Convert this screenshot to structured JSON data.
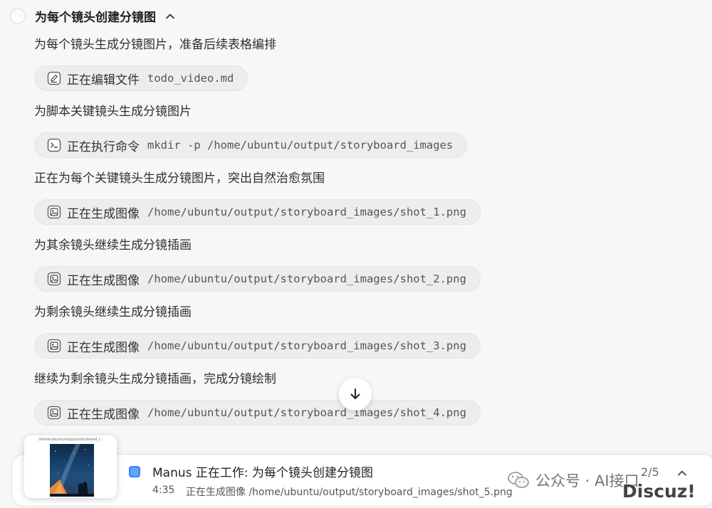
{
  "task": {
    "title": "为每个镜头创建分镜图"
  },
  "steps": [
    {
      "text": "为每个镜头生成分镜图片，准备后续表格编排",
      "tool": {
        "icon": "edit-icon",
        "label": "正在编辑文件",
        "arg": "todo_video.md"
      }
    },
    {
      "text": "为脚本关键镜头生成分镜图片",
      "tool": {
        "icon": "terminal-icon",
        "label": "正在执行命令",
        "arg": "mkdir -p /home/ubuntu/output/storyboard_images"
      }
    },
    {
      "text": "正在为每个关键镜头生成分镜图片，突出自然治愈氛围",
      "tool": {
        "icon": "image-icon",
        "label": "正在生成图像",
        "arg": "/home/ubuntu/output/storyboard_images/shot_1.png"
      }
    },
    {
      "text": "为其余镜头继续生成分镜插画",
      "tool": {
        "icon": "image-icon",
        "label": "正在生成图像",
        "arg": "/home/ubuntu/output/storyboard_images/shot_2.png"
      }
    },
    {
      "text": "为剩余镜头继续生成分镜插画",
      "tool": {
        "icon": "image-icon",
        "label": "正在生成图像",
        "arg": "/home/ubuntu/output/storyboard_images/shot_3.png"
      }
    },
    {
      "text": "继续为剩余镜头生成分镜插画，完成分镜绘制",
      "tool": {
        "icon": "image-icon",
        "label": "正在生成图像",
        "arg": "/home/ubuntu/output/storyboard_images/shot_4.png"
      }
    }
  ],
  "status": {
    "thumbnail_caption": "/home/ubuntu/output/storyboard_i...",
    "title": "Manus 正在工作: 为每个镜头创建分镜图",
    "time": "4:35",
    "description": "正在生成图像 /home/ubuntu/output/storyboard_images/shot_5.png",
    "progress": "2/5"
  },
  "watermark": {
    "text": "公众号 · AI接口",
    "site": "Discuz!"
  },
  "colors": {
    "background": "#f7f7f6",
    "pill": "#ededec",
    "accent": "#3b82f6"
  }
}
